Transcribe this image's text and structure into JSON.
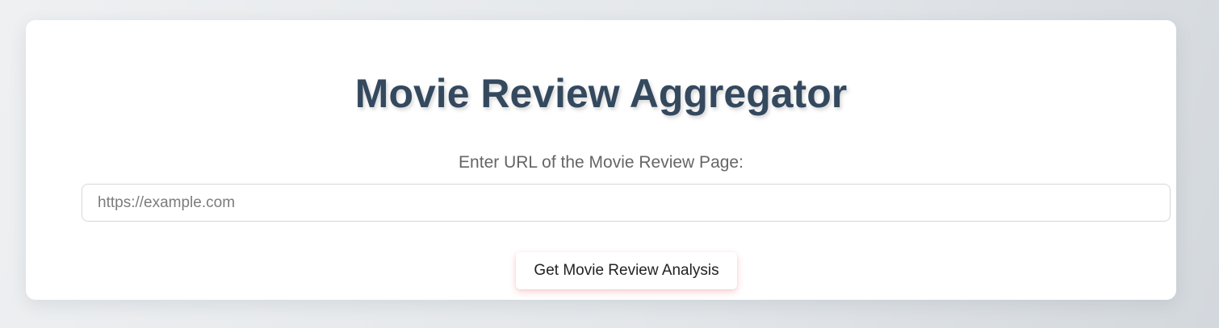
{
  "page": {
    "title": "Movie Review Aggregator"
  },
  "form": {
    "url_label": "Enter URL of the Movie Review Page:",
    "url_value": "",
    "url_placeholder": "https://example.com",
    "submit_label": "Get Movie Review Analysis"
  },
  "colors": {
    "title": "#34495e",
    "label": "#656565",
    "card_background": "#ffffff"
  }
}
